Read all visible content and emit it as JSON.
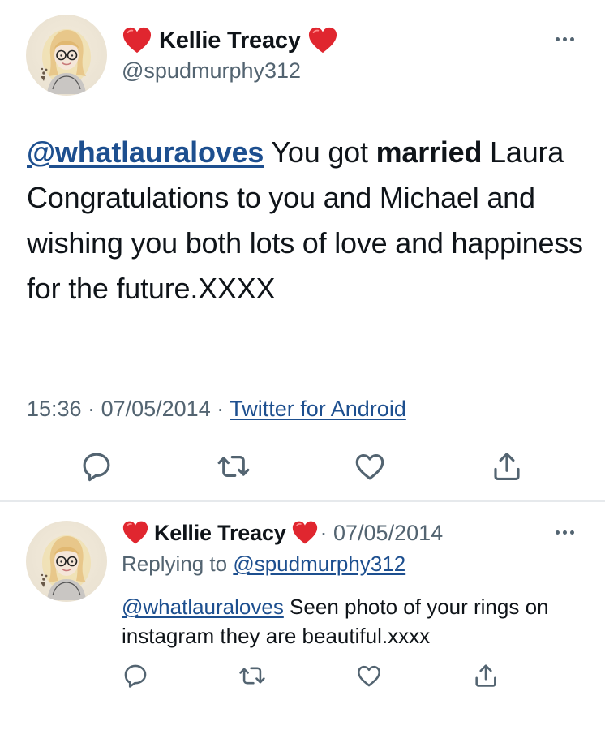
{
  "main_tweet": {
    "author": {
      "display_name": "Kellie Treacy",
      "handle": "@spudmurphy312",
      "name_emoji": "red-heart-icon"
    },
    "text_parts": {
      "mention": "@whatlauraloves",
      "before_bold": " You got ",
      "bold": "married",
      "after_bold": " Laura Congratulations to you and Michael and wishing you both lots of love and happiness for the future.XXXX"
    },
    "time": "15:36",
    "separator": " · ",
    "date": "07/05/2014",
    "source": "Twitter for Android",
    "actions": [
      "reply-icon",
      "retweet-icon",
      "like-icon",
      "share-icon"
    ]
  },
  "reply_tweet": {
    "author": {
      "display_name": "Kellie Treacy",
      "name_emoji": "red-heart-icon"
    },
    "date": "· 07/05/2014",
    "replying_prefix": "Replying to ",
    "replying_to": "@spudmurphy312",
    "mention": "@whatlauraloves",
    "text": " Seen photo of your rings on instagram they are beautiful.xxxx",
    "actions": [
      "reply-icon",
      "retweet-icon",
      "like-icon",
      "share-icon"
    ]
  },
  "colors": {
    "text": "#0f1419",
    "secondary": "#536471",
    "link": "#1d4f8f",
    "heart": "#e0262f",
    "divider": "#e6e9ec"
  }
}
